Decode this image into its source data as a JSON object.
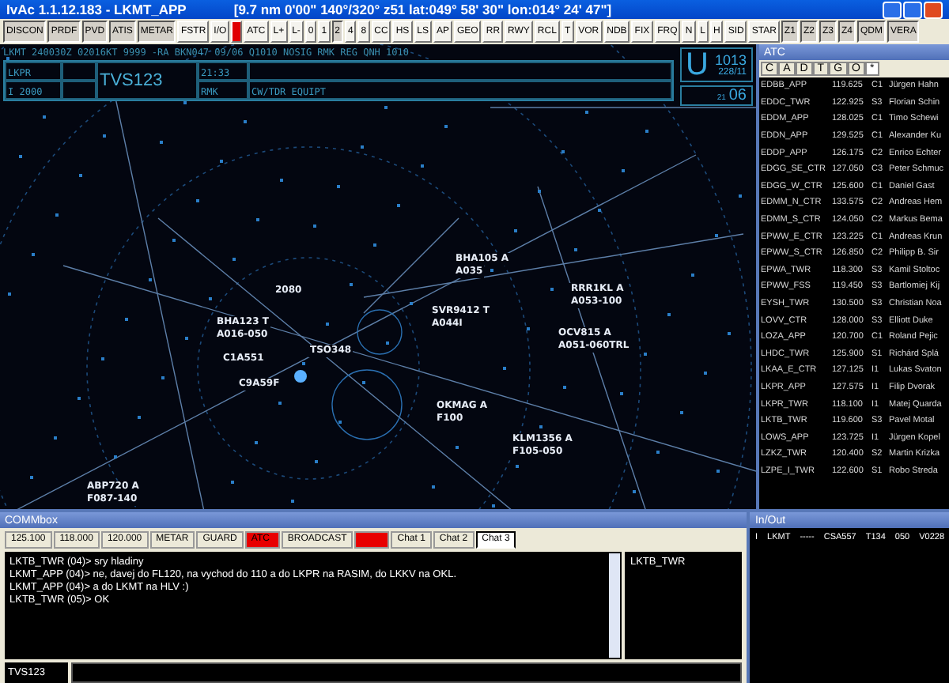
{
  "window": {
    "title": "IvAc 1.1.12.183  - LKMT_APP",
    "status": "[9.7 nm   0'00\"   140°/320°   z51   lat:049° 58' 30\" lon:014° 24' 47\"]"
  },
  "toolbar": [
    {
      "label": "DISCON",
      "pressed": true,
      "alert": false
    },
    {
      "label": "PRDF",
      "pressed": true,
      "alert": false
    },
    {
      "label": "PVD",
      "pressed": true,
      "alert": false
    },
    {
      "label": "ATIS",
      "pressed": true,
      "alert": false
    },
    {
      "label": "METAR",
      "pressed": true,
      "alert": false
    },
    {
      "label": "FSTR",
      "pressed": false,
      "alert": false
    },
    {
      "label": "I/O",
      "pressed": false,
      "alert": false
    },
    {
      "pressed": false,
      "alert": true
    },
    {
      "label": "ATC",
      "pressed": false,
      "alert": false
    },
    {
      "label": "L+",
      "pressed": false,
      "alert": false
    },
    {
      "label": "L-",
      "pressed": false,
      "alert": false
    },
    {
      "label": "0",
      "pressed": false,
      "alert": false
    },
    {
      "label": "1",
      "pressed": false,
      "alert": false
    },
    {
      "label": "2",
      "pressed": true,
      "alert": false
    },
    {
      "label": "4",
      "pressed": false,
      "alert": false
    },
    {
      "label": "8",
      "pressed": false,
      "alert": false
    },
    {
      "label": "CC",
      "pressed": false,
      "alert": false
    },
    {
      "label": "HS",
      "pressed": false,
      "alert": false
    },
    {
      "label": "LS",
      "pressed": false,
      "alert": false
    },
    {
      "label": "AP",
      "pressed": false,
      "alert": false
    },
    {
      "label": "GEO",
      "pressed": false,
      "alert": false
    },
    {
      "label": "RR",
      "pressed": false,
      "alert": false
    },
    {
      "label": "RWY",
      "pressed": false,
      "alert": false
    },
    {
      "label": "RCL",
      "pressed": false,
      "alert": false
    },
    {
      "label": "T",
      "pressed": false,
      "alert": false
    },
    {
      "label": "VOR",
      "pressed": false,
      "alert": false
    },
    {
      "label": "NDB",
      "pressed": false,
      "alert": false
    },
    {
      "label": "FIX",
      "pressed": false,
      "alert": false
    },
    {
      "label": "FRQ",
      "pressed": false,
      "alert": false
    },
    {
      "label": "N",
      "pressed": false,
      "alert": false
    },
    {
      "label": "L",
      "pressed": false,
      "alert": false
    },
    {
      "label": "H",
      "pressed": false,
      "alert": false
    },
    {
      "label": "SID",
      "pressed": false,
      "alert": false
    },
    {
      "label": "STAR",
      "pressed": false,
      "alert": false
    },
    {
      "label": "Z1",
      "pressed": true,
      "alert": false
    },
    {
      "label": "Z2",
      "pressed": true,
      "alert": false
    },
    {
      "label": "Z3",
      "pressed": true,
      "alert": false
    },
    {
      "label": "Z4",
      "pressed": true,
      "alert": false
    },
    {
      "label": "QDM",
      "pressed": true,
      "alert": false
    },
    {
      "label": "VERA",
      "pressed": true,
      "alert": false
    }
  ],
  "metar": "LKMT 240030Z 02016KT 9999 -RA BKN047 09/06 Q1010 NOSIG RMK REG QNH 1010",
  "strip": {
    "departure": "LKPR",
    "rules": "I",
    "altitude": "2000",
    "callsign": "TVS123",
    "time": "21:33",
    "remarks_label": "RMK",
    "remarks": "CW/TDR EQUIPT"
  },
  "pressure": {
    "letter": "U",
    "qnh": "1013",
    "wind": "228/11",
    "minute_prefix": "21",
    "minute": "06"
  },
  "targets": [
    {
      "line1": "BHA105 A",
      "line2": "A035"
    },
    {
      "line1": "2080"
    },
    {
      "line1": "SVR9412 T",
      "line2": "A044I"
    },
    {
      "line1": "RRR1KL A",
      "line2": "A053-100"
    },
    {
      "line1": "BHA123 T",
      "line2": "A016-050"
    },
    {
      "line1": "OCV815 A",
      "line2": "A051-060TRL"
    },
    {
      "line1": "TSO348"
    },
    {
      "line1": "C1A551"
    },
    {
      "line1": "C9A59F"
    },
    {
      "line1": "OKMAG A",
      "line2": "F100"
    },
    {
      "line1": "KLM1356 A",
      "line2": "F105-050"
    },
    {
      "line1": "ABP720 A",
      "line2": "F087-140"
    }
  ],
  "atc": {
    "title": "ATC",
    "tabs": [
      {
        "label": "C",
        "selected": false
      },
      {
        "label": "A",
        "selected": false
      },
      {
        "label": "D",
        "selected": false
      },
      {
        "label": "T",
        "selected": false
      },
      {
        "label": "G",
        "selected": false
      },
      {
        "label": "O",
        "selected": false
      },
      {
        "label": "*",
        "selected": true
      }
    ],
    "rows": [
      [
        "EDBB_APP",
        "119.625",
        "C1",
        "Jürgen Hahn"
      ],
      [
        "EDDC_TWR",
        "122.925",
        "S3",
        "Florian Schin"
      ],
      [
        "EDDM_APP",
        "128.025",
        "C1",
        "Timo Schewi"
      ],
      [
        "EDDN_APP",
        "129.525",
        "C1",
        "Alexander Ku"
      ],
      [
        "EDDP_APP",
        "126.175",
        "C2",
        "Enrico Echter"
      ],
      [
        "EDGG_SE_CTR",
        "127.050",
        "C3",
        "Peter Schmuc"
      ],
      [
        "EDGG_W_CTR",
        "125.600",
        "C1",
        "Daniel Gast"
      ],
      [
        "EDMM_N_CTR",
        "133.575",
        "C2",
        "Andreas Hem"
      ],
      [
        "EDMM_S_CTR",
        "124.050",
        "C2",
        "Markus Bema"
      ],
      [
        "EPWW_E_CTR",
        "123.225",
        "C1",
        "Andreas Krun"
      ],
      [
        "EPWW_S_CTR",
        "126.850",
        "C2",
        "Philipp B. Sir"
      ],
      [
        "EPWA_TWR",
        "118.300",
        "S3",
        "Kamil Stoltoc"
      ],
      [
        "EPWW_FSS",
        "119.450",
        "S3",
        "Bartlomiej Kij"
      ],
      [
        "EYSH_TWR",
        "130.500",
        "S3",
        "Christian Noa"
      ],
      [
        "LOVV_CTR",
        "128.000",
        "S3",
        "Elliott Duke"
      ],
      [
        "LOZA_APP",
        "120.700",
        "C1",
        "Roland Pejic"
      ],
      [
        "LHDC_TWR",
        "125.900",
        "S1",
        "Richárd Splá"
      ],
      [
        "LKAA_E_CTR",
        "127.125",
        "I1",
        "Lukas Svaton"
      ],
      [
        "LKPR_APP",
        "127.575",
        "I1",
        "Filip Dvorak"
      ],
      [
        "LKPR_TWR",
        "118.100",
        "I1",
        "Matej Quarda"
      ],
      [
        "LKTB_TWR",
        "119.600",
        "S3",
        "Pavel Motal"
      ],
      [
        "LOWS_APP",
        "123.725",
        "I1",
        "Jürgen Kopel"
      ],
      [
        "LZKZ_TWR",
        "120.400",
        "S2",
        "Martin Krizka"
      ],
      [
        "LZPE_I_TWR",
        "122.600",
        "S1",
        "Robo Streda"
      ]
    ]
  },
  "comm": {
    "title": "COMMbox",
    "tabs": [
      {
        "label": "125.100",
        "selected": false,
        "alert": false
      },
      {
        "label": "118.000",
        "selected": false,
        "alert": false
      },
      {
        "label": "120.000",
        "selected": false,
        "alert": false
      },
      {
        "label": "METAR",
        "selected": false,
        "alert": false
      },
      {
        "label": "GUARD",
        "selected": false,
        "alert": false
      },
      {
        "label": "ATC",
        "selected": false,
        "alert": true
      },
      {
        "label": "BROADCAST",
        "selected": false,
        "alert": false
      },
      {
        "selected": false,
        "alert": true
      },
      {
        "label": "Chat 1",
        "selected": false,
        "alert": false
      },
      {
        "label": "Chat 2",
        "selected": false,
        "alert": false
      },
      {
        "label": "Chat 3",
        "selected": true,
        "alert": false
      }
    ],
    "messages": [
      "LKTB_TWR (04)> sry hladiny",
      "LKMT_APP (04)> ne, davej do FL120, na vychod do 110 a do LKPR na RASIM, do LKKV na OKL.",
      "LKMT_APP (04)> a do LKMT na HLV :)",
      "LKTB_TWR (05)> OK"
    ],
    "participants": [
      "LKTB_TWR"
    ],
    "callsign": "TVS123"
  },
  "inout": {
    "title": "In/Out",
    "rows": [
      [
        "I",
        "LKMT",
        "-----",
        "CSA557",
        "T134",
        "050",
        "V0228"
      ]
    ]
  }
}
